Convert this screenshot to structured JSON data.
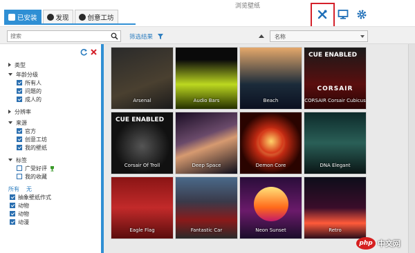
{
  "window": {
    "title": "浏览壁纸"
  },
  "tabs": [
    {
      "label": "已安装"
    },
    {
      "label": "发现"
    },
    {
      "label": "创意工坊"
    }
  ],
  "search": {
    "placeholder": "搜索"
  },
  "filter": {
    "label": "筛选结果"
  },
  "sort": {
    "value": "名称"
  },
  "sidebar": {
    "groups": [
      {
        "label": "类型",
        "expanded": false
      },
      {
        "label": "年龄分级",
        "expanded": true,
        "children": [
          "所有人",
          "问题的",
          "成人的"
        ]
      },
      {
        "label": "分辨率",
        "expanded": false
      },
      {
        "label": "来源",
        "expanded": true,
        "children": [
          "官方",
          "创意工坊",
          "我的壁纸"
        ]
      },
      {
        "label": "标签",
        "expanded": true,
        "children": [
          "广受好评",
          "我的收藏"
        ]
      }
    ],
    "all_label": "所有",
    "none_label": "无",
    "tag_children": [
      "抽象壁纸作式",
      "动物",
      "动物",
      "动漫"
    ]
  },
  "wallpapers": [
    {
      "name": "Arsenal",
      "logo": "",
      "bg": "linear-gradient(160deg,#2a2a2a,#4a4030 60%,#1a1a1a)"
    },
    {
      "name": "Audio Bars",
      "logo": "",
      "bg": "linear-gradient(180deg,#0a0a0a 20%,#bcd820 60%,#253000)"
    },
    {
      "name": "Beach",
      "logo": "",
      "bg": "linear-gradient(180deg,#e5a86b,#1b2b3a 60%,#0b1020)"
    },
    {
      "name": "CORSAIR Corsair Cubicus",
      "logo": "CUE ENABLED",
      "sub": "CORSAIR",
      "bg": "linear-gradient(180deg,#1a1a1a,#5a0e0e 60%,#2a0505)"
    },
    {
      "name": "Corsair Of Troll",
      "logo": "CUE ENABLED",
      "bg": "radial-gradient(circle at 50% 55%,#555 0%,#111 60%)"
    },
    {
      "name": "Deep Space",
      "logo": "",
      "bg": "linear-gradient(160deg,#1a0d24,#6a4a6a 40%,#d69a70 55%,#0d0d1a)"
    },
    {
      "name": "Demon Core",
      "logo": "",
      "bg": "radial-gradient(circle,#ffc46a 10%,#c22a12 35%,#2a0400 70%)"
    },
    {
      "name": "DNA Elegant",
      "logo": "",
      "bg": "linear-gradient(180deg,#0d2a2a,#2a5f57 50%,#0a1515)"
    },
    {
      "name": "Eagle Flag",
      "logo": "",
      "bg": "linear-gradient(180deg,#8a1515,#c22a2a 50%,#5a0d0d)"
    },
    {
      "name": "Fantastic Car",
      "logo": "",
      "bg": "linear-gradient(180deg,#4a6a8a,#3a3a4a 40%,#8a1a1a 70%,#2a2a2a)"
    },
    {
      "name": "Neon Sunset",
      "logo": "",
      "bg": "linear-gradient(180deg,#2a0d3a,#6a1a6a 55%,#1a0d2a)"
    },
    {
      "name": "Retro",
      "logo": "",
      "bg": "linear-gradient(180deg,#0d0d1a,#3a0d2a 50%,#ff5a3a 75%,#2a0d1a)"
    }
  ],
  "watermark": {
    "badge": "php",
    "text": "中文网"
  }
}
